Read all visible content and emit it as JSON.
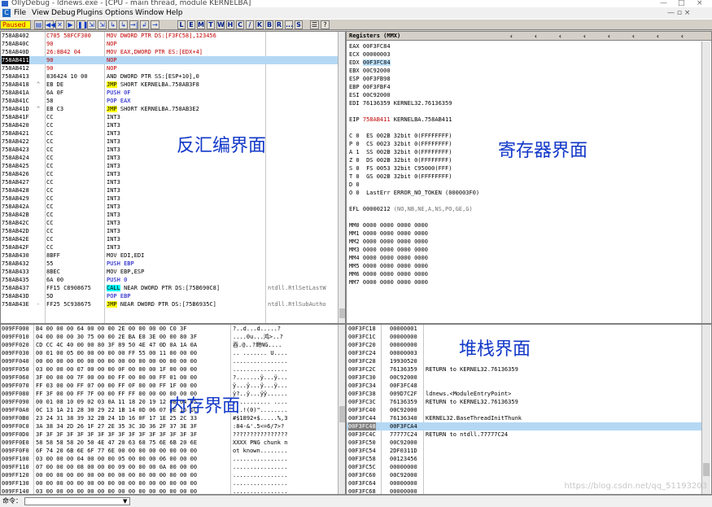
{
  "window": {
    "title": "OllyDebug - ldnews.exe - [CPU - main thread, module KERNELBA]",
    "controls": [
      "—",
      "□",
      "×"
    ]
  },
  "menu": {
    "items": [
      "File",
      "View",
      "Debug",
      "Plugins",
      "Options",
      "Window",
      "Help"
    ],
    "right_controls": "— ▫ ×"
  },
  "toolbar": {
    "status": "Paused",
    "buttons": [
      "▤",
      "◀◀",
      "✕",
      "▶",
      "❚❚",
      "⇲",
      "⇲",
      "↳",
      "↳",
      "→|",
      "↲",
      "→"
    ],
    "letters": [
      "L",
      "E",
      "M",
      "T",
      "W",
      "H",
      "C",
      "/",
      "K",
      "B",
      "R",
      "...",
      "S"
    ],
    "right": [
      "☰",
      "?"
    ]
  },
  "disasm": {
    "rows": [
      {
        "addr": "758AB402",
        "hex": "C705 58FCF300",
        "instr": "MOV DWORD PTR DS:[F3FC58],123456",
        "cmt": ""
      },
      {
        "addr": "758AB40C",
        "hex": "90",
        "instr": "NOP",
        "cmt": ""
      },
      {
        "addr": "758AB40D",
        "hex": "26:8B42 04",
        "instr": "MOV EAX,DWORD PTR ES:[EDX+4]",
        "cmt": ""
      },
      {
        "addr": "758AB411",
        "hex": "90",
        "instr": "NOP",
        "cmt": ""
      },
      {
        "addr": "758AB412",
        "hex": "90",
        "instr": "NOP",
        "cmt": ""
      },
      {
        "addr": "758AB413",
        "hex": "836424 10 00",
        "instr": "AND DWORD PTR SS:[ESP+10],0",
        "cmt": ""
      },
      {
        "addr": "758AB418",
        "hex": "EB DE",
        "instr": "JMP SHORT KERNELBA.758AB3F8",
        "cmt": ""
      },
      {
        "addr": "758AB41A",
        "hex": "6A 0F",
        "instr": "PUSH 0F",
        "cmt": ""
      },
      {
        "addr": "758AB41C",
        "hex": "58",
        "instr": "POP EAX",
        "cmt": ""
      },
      {
        "addr": "758AB41D",
        "hex": "EB C3",
        "instr": "JMP SHORT KERNELBA.758AB3E2",
        "cmt": ""
      },
      {
        "addr": "758AB41F",
        "hex": "CC",
        "instr": "INT3",
        "cmt": ""
      },
      {
        "addr": "758AB420",
        "hex": "CC",
        "instr": "INT3",
        "cmt": ""
      },
      {
        "addr": "758AB421",
        "hex": "CC",
        "instr": "INT3",
        "cmt": ""
      },
      {
        "addr": "758AB422",
        "hex": "CC",
        "instr": "INT3",
        "cmt": ""
      },
      {
        "addr": "758AB423",
        "hex": "CC",
        "instr": "INT3",
        "cmt": ""
      },
      {
        "addr": "758AB424",
        "hex": "CC",
        "instr": "INT3",
        "cmt": ""
      },
      {
        "addr": "758AB425",
        "hex": "CC",
        "instr": "INT3",
        "cmt": ""
      },
      {
        "addr": "758AB426",
        "hex": "CC",
        "instr": "INT3",
        "cmt": ""
      },
      {
        "addr": "758AB427",
        "hex": "CC",
        "instr": "INT3",
        "cmt": ""
      },
      {
        "addr": "758AB428",
        "hex": "CC",
        "instr": "INT3",
        "cmt": ""
      },
      {
        "addr": "758AB429",
        "hex": "CC",
        "instr": "INT3",
        "cmt": ""
      },
      {
        "addr": "758AB42A",
        "hex": "CC",
        "instr": "INT3",
        "cmt": ""
      },
      {
        "addr": "758AB42B",
        "hex": "CC",
        "instr": "INT3",
        "cmt": ""
      },
      {
        "addr": "758AB42C",
        "hex": "CC",
        "instr": "INT3",
        "cmt": ""
      },
      {
        "addr": "758AB42D",
        "hex": "CC",
        "instr": "INT3",
        "cmt": ""
      },
      {
        "addr": "758AB42E",
        "hex": "CC",
        "instr": "INT3",
        "cmt": ""
      },
      {
        "addr": "758AB42F",
        "hex": "CC",
        "instr": "INT3",
        "cmt": ""
      },
      {
        "addr": "758AB430",
        "hex": "8BFF",
        "instr": "MOV EDI,EDI",
        "cmt": ""
      },
      {
        "addr": "758AB432",
        "hex": "55",
        "instr": "PUSH EBP",
        "cmt": ""
      },
      {
        "addr": "758AB433",
        "hex": "8BEC",
        "instr": "MOV EBP,ESP",
        "cmt": ""
      },
      {
        "addr": "758AB435",
        "hex": "6A 00",
        "instr": "PUSH 0",
        "cmt": ""
      },
      {
        "addr": "758AB437",
        "hex": "FF15 C8908675",
        "instr": "CALL NEAR DWORD PTR DS:[75B690C8]",
        "cmt": "ntdll.RtlSetLastW"
      },
      {
        "addr": "758AB43D",
        "hex": "5D",
        "instr": "POP EBP",
        "cmt": ""
      },
      {
        "addr": "758AB43E",
        "hex": "FF25 5C938675",
        "instr": "JMP NEAR DWORD PTR DS:[75B6935C]",
        "cmt": "ntdll.RtlSubAutho"
      }
    ],
    "prefix": [
      "",
      "",
      "",
      "",
      "",
      "",
      "^",
      "",
      "",
      "^",
      "",
      "",
      "",
      "",
      "",
      "",
      "",
      "",
      "",
      "",
      "",
      "",
      "",
      "",
      "",
      "",
      "",
      "",
      "",
      "",
      "",
      "",
      "",
      "-"
    ],
    "label": "反汇编界面"
  },
  "registers": {
    "header": "Registers (MMX)",
    "lines": [
      "EAX 00F3FC84",
      "ECX 00000003",
      "EDX 00F3FC84",
      "EBX 00C92000",
      "ESP 00F3FB98",
      "EBP 00F3FBF4",
      "ESI 00C92000",
      "EDI 76136359 KERNEL32.76136359",
      "",
      "EIP 758AB411 KERNELBA.758AB411",
      "",
      "C 0  ES 002B 32bit 0(FFFFFFFF)",
      "P 0  CS 0023 32bit 0(FFFFFFFF)",
      "A 1  SS 002B 32bit 0(FFFFFFFF)",
      "Z 0  DS 002B 32bit 0(FFFFFFFF)",
      "S 0  FS 0053 32bit C95000(FFF)",
      "T 0  GS 002B 32bit 0(FFFFFFFF)",
      "D 0",
      "O 0  LastErr ERROR_NO_TOKEN (000003F0)",
      "",
      "EFL 00000212 (NO,NB,NE,A,NS,PO,GE,G)",
      "",
      "MM0 0000 0000 0000 0000",
      "MM1 0000 0000 0000 0000",
      "MM2 0000 0000 0000 0000",
      "MM3 0000 0000 0000 0000",
      "MM4 0000 0000 0000 0000",
      "MM5 0000 0000 0000 0000",
      "MM6 0000 0000 0000 0000",
      "MM7 0000 0000 0000 0000"
    ],
    "label": "寄存器界面"
  },
  "dump": {
    "rows": [
      {
        "addr": "009FF000",
        "hex": "B4 00 00 00 64 00 00 00 2E 00 00 00 00 C0 3F",
        "asc": "?..d...d.....?"
      },
      {
        "addr": "009FF010",
        "hex": "04 00 00 00 30 75 00 00 2E BA E8 3E 00 00 80 3F",
        "asc": "....0u...鸿>..?"
      },
      {
        "addr": "009FF020",
        "hex": "CD CC 4C 40 00 00 80 3F 89 50 4E 47 0D 0A 1A 0A",
        "asc": "吞.@..?塒NG...."
      },
      {
        "addr": "009FF030",
        "hex": "00 01 00 05 00 00 00 00 00 FF 55 00 11 00 00 00",
        "asc": ".. ....... U...."
      },
      {
        "addr": "009FF040",
        "hex": "00 00 00 00 00 00 00 00 00 00 00 00 00 00 00 00",
        "asc": "................"
      },
      {
        "addr": "009FF050",
        "hex": "03 00 00 00 07 00 00 00 0F 00 00 00 1F 00 00 00",
        "asc": "................"
      },
      {
        "addr": "009FF060",
        "hex": "3F 00 00 00 7F 00 00 00 FF 00 00 00 FF 01 00 00",
        "asc": "?.......ÿ...ÿ..."
      },
      {
        "addr": "009FF070",
        "hex": "FF 03 00 00 FF 07 00 00 FF 0F 00 00 FF 1F 00 00",
        "asc": "ÿ...ÿ...ÿ...ÿ..."
      },
      {
        "addr": "009FF080",
        "hex": "FF 3F 00 00 FF 7F 00 00 FF FF 00 00 00 00 00 00",
        "asc": "ÿ?..ÿ...ÿÿ......"
      },
      {
        "addr": "009FF090",
        "hex": "00 01 08 10 09 02 03 0A 11 18 20 19 12 0B 04 05",
        "asc": "........... ...."
      },
      {
        "addr": "009FF0A0",
        "hex": "0C 13 1A 21 28 30 29 22 1B 14 0D 06 07 0E 15 1C",
        "asc": "...!(0)\"........"
      },
      {
        "addr": "009FF0B0",
        "hex": "23 24 31 38 39 32 2B 24 1D 16 0F 17 1E 25 2C 33",
        "asc": "#$1892+$.....%,3"
      },
      {
        "addr": "009FF0C0",
        "hex": "3A 38 34 2D 26 1F 27 2E 35 3C 3D 36 2F 37 3E 3F",
        "asc": ":84-&'.5<=6/7>?"
      },
      {
        "addr": "009FF0D0",
        "hex": "3F 3F 3F 3F 3F 3F 3F 3F 3F 3F 3F 3F 3F 3F 3F 3F",
        "asc": "????????????????"
      },
      {
        "addr": "009FF0E0",
        "hex": "58 58 58 58 20 50 4E 47 20 63 68 75 6E 6B 20 6E",
        "asc": "XXXX PNG chunk n"
      },
      {
        "addr": "009FF0F0",
        "hex": "6F 74 20 6B 6E 6F 77 6E 00 00 00 00 00 00 00 00",
        "asc": "ot known........"
      },
      {
        "addr": "009FF100",
        "hex": "03 00 00 00 04 00 00 00 05 00 00 00 06 00 00 00",
        "asc": "................"
      },
      {
        "addr": "009FF110",
        "hex": "07 00 00 00 08 00 00 00 09 00 00 00 0A 00 00 00",
        "asc": "................"
      },
      {
        "addr": "009FF120",
        "hex": "00 00 00 00 00 00 00 00 00 00 00 00 00 00 00 00",
        "asc": "................"
      },
      {
        "addr": "009FF130",
        "hex": "00 00 00 00 00 00 00 00 00 00 00 00 00 00 00 00",
        "asc": "................"
      },
      {
        "addr": "009FF140",
        "hex": "03 00 00 00 00 00 00 00 00 00 00 00 00 00 00 00",
        "asc": "................"
      }
    ],
    "label": "内存界面"
  },
  "stack": {
    "rows": [
      {
        "addr": "00F3FC18",
        "val": "00000001",
        "cmt": ""
      },
      {
        "addr": "00F3FC1C",
        "val": "00000000",
        "cmt": ""
      },
      {
        "addr": "00F3FC20",
        "val": "00000000",
        "cmt": ""
      },
      {
        "addr": "00F3FC24",
        "val": "00000003",
        "cmt": ""
      },
      {
        "addr": "00F3FC28",
        "val": "19930520",
        "cmt": ""
      },
      {
        "addr": "00F3FC2C",
        "val": "76136359",
        "cmt": "RETURN to KERNEL32.76136359"
      },
      {
        "addr": "00F3FC30",
        "val": "00C92000",
        "cmt": ""
      },
      {
        "addr": "00F3FC34",
        "val": "00F3FC48",
        "cmt": ""
      },
      {
        "addr": "00F3FC38",
        "val": "009D7C2F",
        "cmt": "ldnews.<ModuleEntryPoint>"
      },
      {
        "addr": "00F3FC3C",
        "val": "76136359",
        "cmt": "RETURN to KERNEL32.76136359"
      },
      {
        "addr": "00F3FC40",
        "val": "00C92000",
        "cmt": ""
      },
      {
        "addr": "00F3FC44",
        "val": "76136340",
        "cmt": "KERNEL32.BaseThreadInitThunk"
      },
      {
        "addr": "00F3FC48",
        "val": "00F3FCA4",
        "cmt": ""
      },
      {
        "addr": "00F3FC4C",
        "val": "77777C24",
        "cmt": "RETURN to ntdll.77777C24"
      },
      {
        "addr": "00F3FC50",
        "val": "00C92000",
        "cmt": ""
      },
      {
        "addr": "00F3FC54",
        "val": "2DF0311D",
        "cmt": ""
      },
      {
        "addr": "00F3FC58",
        "val": "00123456",
        "cmt": ""
      },
      {
        "addr": "00F3FC5C",
        "val": "00000000",
        "cmt": ""
      },
      {
        "addr": "00F3FC60",
        "val": "00C92000",
        "cmt": ""
      },
      {
        "addr": "00F3FC64",
        "val": "00000000",
        "cmt": ""
      },
      {
        "addr": "00F3FC68",
        "val": "00000000",
        "cmt": ""
      }
    ],
    "label": "堆栈界面"
  },
  "cmd": {
    "label": "命令："
  },
  "watermark": "https://blog.csdn.net/qq_51193203"
}
